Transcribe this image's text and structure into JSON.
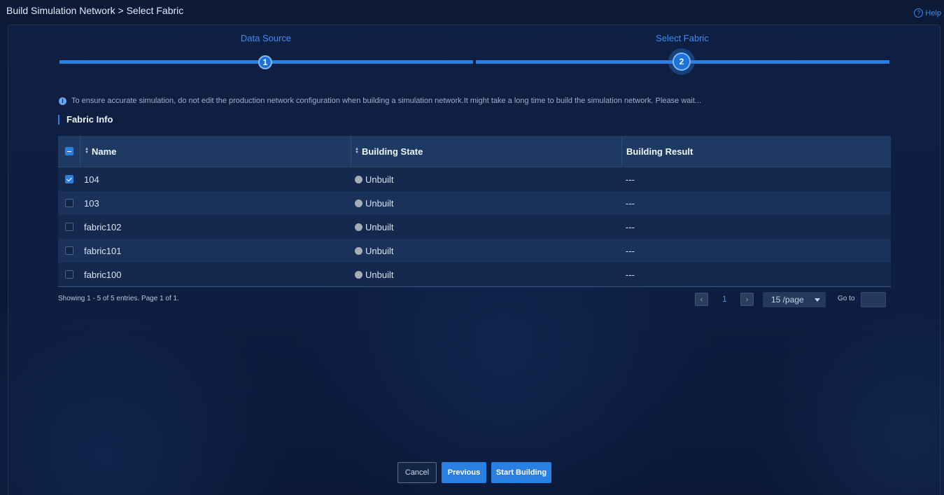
{
  "header": {
    "breadcrumb": "Build Simulation Network > Select Fabric",
    "help_label": "Help"
  },
  "steps": [
    {
      "label": "Data Source",
      "number": "1"
    },
    {
      "label": "Select Fabric",
      "number": "2"
    }
  ],
  "notice": {
    "text": "To ensure accurate simulation, do not edit the production network configuration when building a simulation network.It might take a long time to build the simulation network. Please wait..."
  },
  "section": {
    "title": "Fabric Info"
  },
  "table": {
    "columns": {
      "name": "Name",
      "state": "Building State",
      "result": "Building Result"
    },
    "rows": [
      {
        "name": "104",
        "state": "Unbuilt",
        "result": "---",
        "checked": true
      },
      {
        "name": "103",
        "state": "Unbuilt",
        "result": "---",
        "checked": false
      },
      {
        "name": "fabric102",
        "state": "Unbuilt",
        "result": "---",
        "checked": false
      },
      {
        "name": "fabric101",
        "state": "Unbuilt",
        "result": "---",
        "checked": false
      },
      {
        "name": "fabric100",
        "state": "Unbuilt",
        "result": "---",
        "checked": false
      }
    ]
  },
  "pagination": {
    "summary": "Showing 1 - 5 of 5 entries. Page 1 of 1.",
    "prev_symbol": "‹",
    "next_symbol": "›",
    "current_page": "1",
    "per_page": "15 /page",
    "goto_label": "Go to",
    "goto_value": ""
  },
  "actions": {
    "cancel": "Cancel",
    "previous": "Previous",
    "start": "Start Building"
  },
  "colors": {
    "accent": "#2d7fe0",
    "background": "#0b1a3a",
    "unbuilt_dot": "#a7adb5"
  }
}
